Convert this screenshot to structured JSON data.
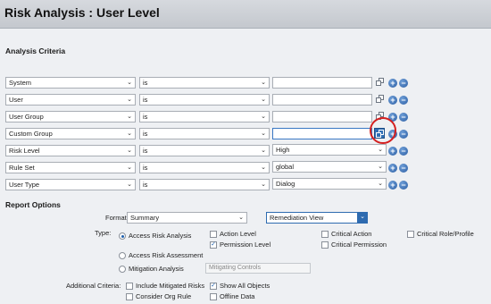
{
  "page": {
    "title": "Risk Analysis : User Level"
  },
  "criteria": {
    "heading": "Analysis Criteria",
    "rows": [
      {
        "field": "System",
        "operator": "is",
        "value": ""
      },
      {
        "field": "User",
        "operator": "is",
        "value": ""
      },
      {
        "field": "User Group",
        "operator": "is",
        "value": ""
      },
      {
        "field": "Custom Group",
        "operator": "is",
        "value": ""
      },
      {
        "field": "Risk Level",
        "operator": "is",
        "value": "High"
      },
      {
        "field": "Rule Set",
        "operator": "is",
        "value": "global"
      },
      {
        "field": "User Type",
        "operator": "is",
        "value": "Dialog"
      }
    ]
  },
  "report": {
    "heading": "Report Options",
    "format_label": "Format:",
    "format_value": "Summary",
    "view_value": "Remediation View",
    "type_label": "Type:",
    "types": [
      "Access Risk Analysis",
      "Access Risk Assessment",
      "Mitigation Analysis"
    ],
    "mitigating_placeholder": "Mitigating Controls",
    "levels": [
      "Action Level",
      "Permission Level"
    ],
    "critical": [
      "Critical Action",
      "Critical Permission",
      "Critical Role/Profile"
    ],
    "additional_label": "Additional Criteria:",
    "additional": [
      "Include Mitigated Risks",
      "Consider Org Rule",
      "Show All Objects",
      "Offline Data"
    ]
  },
  "icons": {
    "add": "plus-circle-icon",
    "remove": "minus-circle-icon",
    "copy": "multiple-selection-icon",
    "dropdown": "chevron-down-icon"
  },
  "colors": {
    "accent": "#2e6bb0",
    "highlight": "#d41f1f"
  }
}
